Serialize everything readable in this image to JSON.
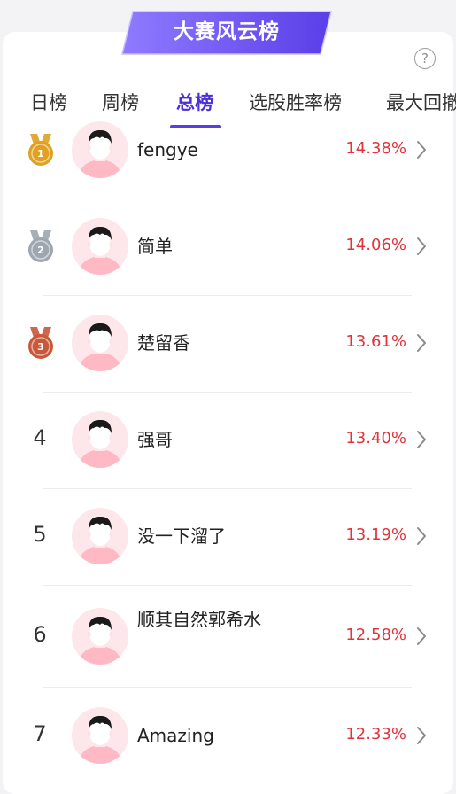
{
  "banner": {
    "title": "大赛风云榜"
  },
  "help": {
    "label": "?"
  },
  "tabs": [
    {
      "label": "日榜",
      "active": false
    },
    {
      "label": "周榜",
      "active": false
    },
    {
      "label": "总榜",
      "active": true
    },
    {
      "label": "选股胜率榜",
      "active": false
    },
    {
      "label": "最大回撤",
      "active": false
    }
  ],
  "colors": {
    "accent": "#5b3ce6",
    "rate": "#e0333b",
    "gold": "#e0a020",
    "silver": "#9ea6b0",
    "bronze": "#c8583a"
  },
  "ranking": [
    {
      "rank": "1",
      "medal": "gold",
      "name": "fengye",
      "rate": "14.38%"
    },
    {
      "rank": "2",
      "medal": "silver",
      "name": "简单",
      "rate": "14.06%"
    },
    {
      "rank": "3",
      "medal": "bronze",
      "name": "楚留香",
      "rate": "13.61%"
    },
    {
      "rank": "4",
      "medal": "",
      "name": "强哥",
      "rate": "13.40%"
    },
    {
      "rank": "5",
      "medal": "",
      "name": "没一下溜了",
      "rate": "13.19%"
    },
    {
      "rank": "6",
      "medal": "",
      "name": "顺其自然郭希水",
      "rate": "12.58%"
    },
    {
      "rank": "7",
      "medal": "",
      "name": "Amazing",
      "rate": "12.33%"
    }
  ]
}
